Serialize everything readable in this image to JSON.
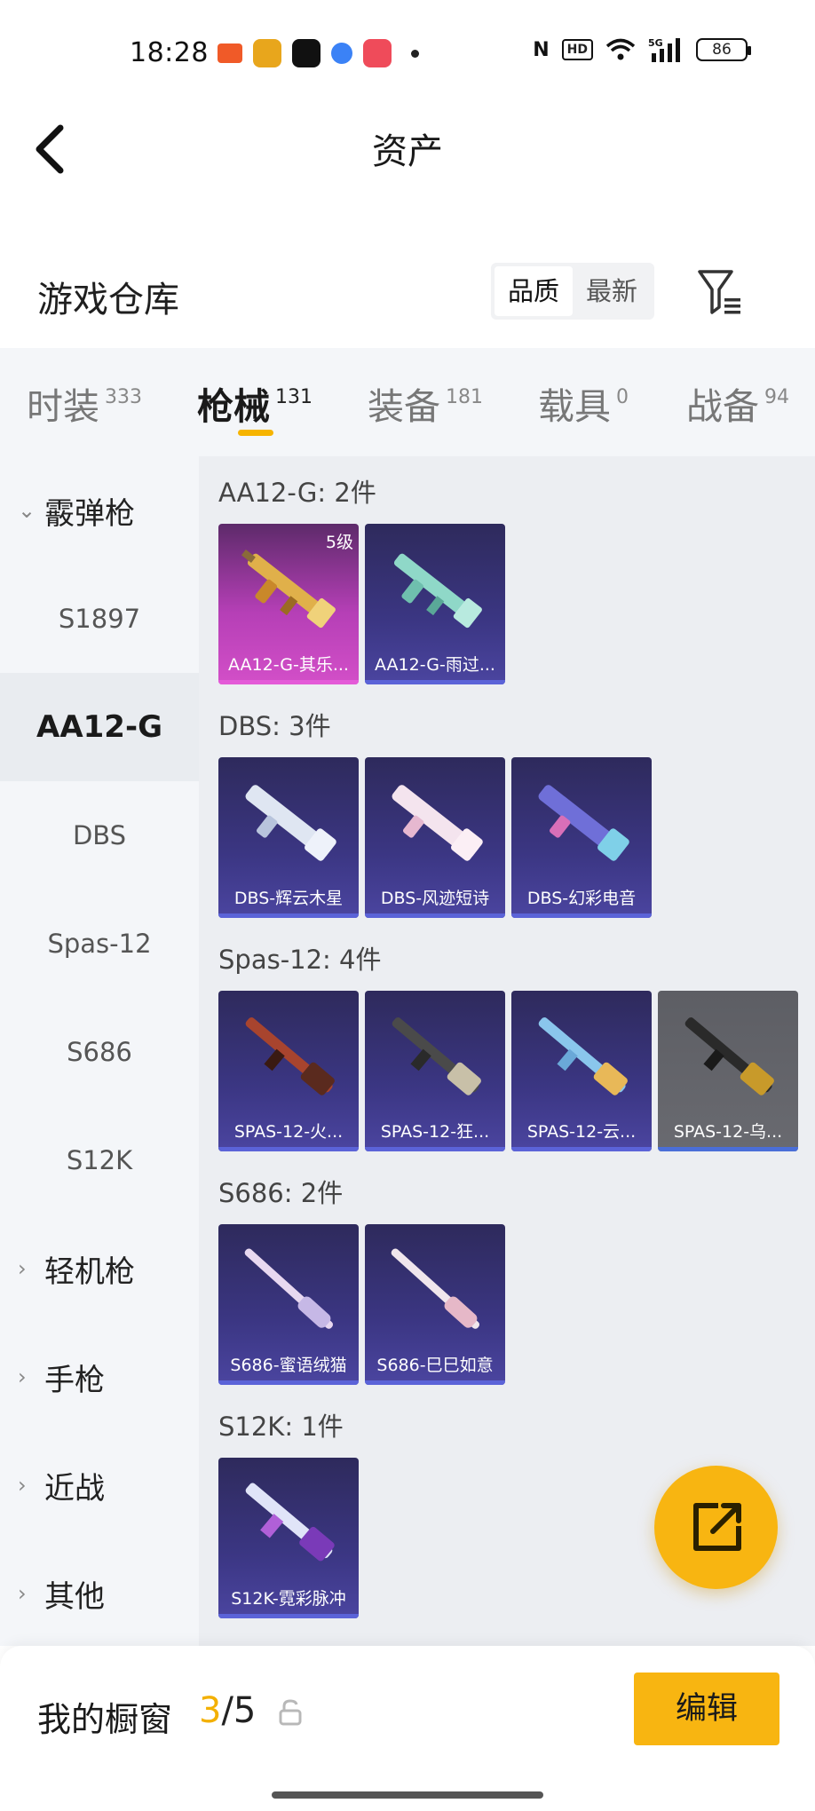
{
  "status_bar": {
    "time": "18:28",
    "battery": "86",
    "icons": [
      "nfc-icon",
      "hd-icon",
      "wifi-icon",
      "5g-signal-icon",
      "battery-icon"
    ]
  },
  "header": {
    "title": "资产"
  },
  "section": {
    "title": "游戏仓库",
    "sort_options": [
      {
        "label": "品质",
        "active": true
      },
      {
        "label": "最新",
        "active": false
      }
    ]
  },
  "tabs": [
    {
      "label": "时装",
      "count": "333",
      "active": false
    },
    {
      "label": "枪械",
      "count": "131",
      "active": true
    },
    {
      "label": "装备",
      "count": "181",
      "active": false
    },
    {
      "label": "载具",
      "count": "0",
      "active": false
    },
    {
      "label": "战备",
      "count": "94",
      "active": false
    }
  ],
  "sidebar": {
    "items": [
      {
        "label": "霰弹枪",
        "type": "category",
        "expanded": true
      },
      {
        "label": "S1897",
        "type": "sub"
      },
      {
        "label": "AA12-G",
        "type": "sub",
        "selected": true
      },
      {
        "label": "DBS",
        "type": "sub"
      },
      {
        "label": "Spas-12",
        "type": "sub"
      },
      {
        "label": "S686",
        "type": "sub"
      },
      {
        "label": "S12K",
        "type": "sub"
      },
      {
        "label": "轻机枪",
        "type": "category",
        "expanded": false
      },
      {
        "label": "手枪",
        "type": "category",
        "expanded": false
      },
      {
        "label": "近战",
        "type": "category",
        "expanded": false
      },
      {
        "label": "其他",
        "type": "category",
        "expanded": false
      }
    ]
  },
  "groups": [
    {
      "title": "AA12-G: 2件",
      "items": [
        {
          "name": "AA12-G-其乐...",
          "style": "pink",
          "level": "5级"
        },
        {
          "name": "AA12-G-雨过...",
          "style": "blue"
        }
      ]
    },
    {
      "title": "DBS: 3件",
      "items": [
        {
          "name": "DBS-辉云木星",
          "style": "blue"
        },
        {
          "name": "DBS-风迹短诗",
          "style": "blue"
        },
        {
          "name": "DBS-幻彩电音",
          "style": "blue"
        }
      ]
    },
    {
      "title": "Spas-12: 4件",
      "items": [
        {
          "name": "SPAS-12-火...",
          "style": "blue"
        },
        {
          "name": "SPAS-12-狂...",
          "style": "blue"
        },
        {
          "name": "SPAS-12-云...",
          "style": "blue"
        },
        {
          "name": "SPAS-12-乌...",
          "style": "gray"
        }
      ]
    },
    {
      "title": "S686: 2件",
      "items": [
        {
          "name": "S686-蜜语绒猫",
          "style": "blue"
        },
        {
          "name": "S686-巳巳如意",
          "style": "blue"
        }
      ]
    },
    {
      "title": "S12K: 1件",
      "items": [
        {
          "name": "S12K-霓彩脉冲",
          "style": "blue"
        }
      ]
    }
  ],
  "bottom": {
    "showcase_label": "我的橱窗",
    "current": "3",
    "total": "/5",
    "edit_label": "编辑"
  }
}
